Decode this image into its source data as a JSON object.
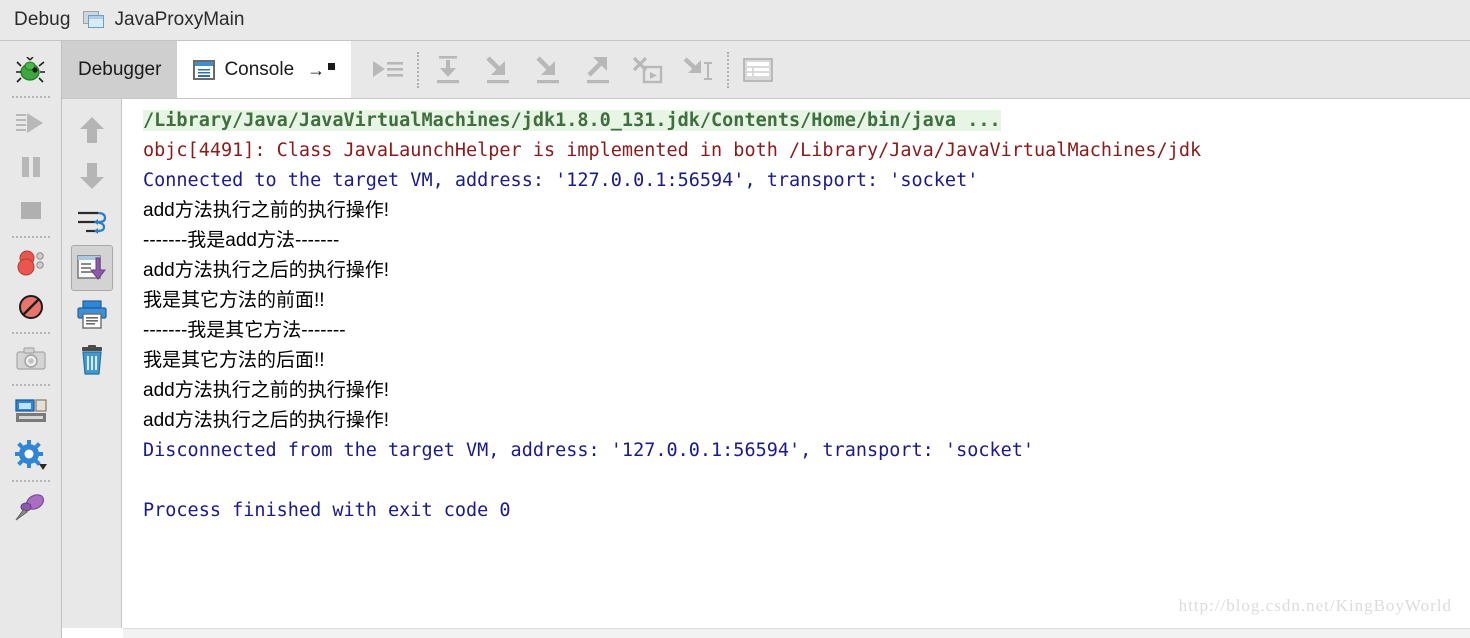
{
  "header": {
    "label": "Debug",
    "icon": "window-icon",
    "config_name": "JavaProxyMain"
  },
  "left_rail": {
    "items": [
      {
        "name": "debug-bug-icon",
        "title": "Debug"
      },
      {
        "name": "resume-program-icon",
        "title": "Resume Program"
      },
      {
        "name": "pause-program-icon",
        "title": "Pause Program"
      },
      {
        "name": "stop-icon",
        "title": "Stop"
      },
      {
        "name": "view-breakpoints-icon",
        "title": "View Breakpoints"
      },
      {
        "name": "mute-breakpoints-icon",
        "title": "Mute Breakpoints"
      },
      {
        "name": "camera-snapshot-icon",
        "title": "Get Thread Dump"
      },
      {
        "name": "restore-layout-icon",
        "title": "Restore Layout"
      },
      {
        "name": "settings-gear-icon",
        "title": "Settings"
      },
      {
        "name": "pin-tab-icon",
        "title": "Pin Tab"
      }
    ]
  },
  "tabs": [
    {
      "label": "Debugger",
      "active": false,
      "name": "tab-debugger"
    },
    {
      "label": "Console",
      "active": true,
      "name": "tab-console",
      "icon": "console-icon"
    }
  ],
  "toolbar": {
    "buttons": [
      {
        "name": "show-execution-point-icon",
        "title": "Show Execution Point"
      },
      {
        "name": "step-over-icon",
        "title": "Step Over"
      },
      {
        "name": "step-into-icon",
        "title": "Step Into"
      },
      {
        "name": "force-step-into-icon",
        "title": "Force Step Into"
      },
      {
        "name": "step-out-icon",
        "title": "Step Out"
      },
      {
        "name": "drop-frame-icon",
        "title": "Drop Frame"
      },
      {
        "name": "run-to-cursor-icon",
        "title": "Run to Cursor"
      },
      {
        "name": "evaluate-expression-icon",
        "title": "Evaluate Expression"
      }
    ]
  },
  "console_rail": {
    "buttons": [
      {
        "name": "scroll-up-icon",
        "title": "Up the Stack Trace",
        "selected": false
      },
      {
        "name": "scroll-down-icon",
        "title": "Down the Stack Trace",
        "selected": false
      },
      {
        "name": "soft-wrap-icon",
        "title": "Use Soft Wraps",
        "selected": false
      },
      {
        "name": "scroll-to-end-icon",
        "title": "Scroll to the End",
        "selected": true
      },
      {
        "name": "print-icon",
        "title": "Print",
        "selected": false
      },
      {
        "name": "clear-all-icon",
        "title": "Clear All",
        "selected": false
      }
    ]
  },
  "console": {
    "lines": [
      {
        "text": "/Library/Java/JavaVirtualMachines/jdk1.8.0_131.jdk/Contents/Home/bin/java ...",
        "style": "sysout",
        "highlight": true
      },
      {
        "text": "objc[4491]: Class JavaLaunchHelper is implemented in both /Library/Java/JavaVirtualMachines/jdk",
        "style": "error",
        "highlight": false
      },
      {
        "text": "Connected to the target VM, address: '127.0.0.1:56594', transport: 'socket'",
        "style": "info",
        "highlight": false
      },
      {
        "text": "add方法执行之前的执行操作!",
        "style": "plain",
        "highlight": false
      },
      {
        "text": "-------我是add方法-------",
        "style": "plain",
        "highlight": false
      },
      {
        "text": "add方法执行之后的执行操作!",
        "style": "plain",
        "highlight": false
      },
      {
        "text": "我是其它方法的前面!!",
        "style": "plain",
        "highlight": false
      },
      {
        "text": "-------我是其它方法-------",
        "style": "plain",
        "highlight": false
      },
      {
        "text": "我是其它方法的后面!!",
        "style": "plain",
        "highlight": false
      },
      {
        "text": "add方法执行之前的执行操作!",
        "style": "plain",
        "highlight": false
      },
      {
        "text": "add方法执行之后的执行操作!",
        "style": "plain",
        "highlight": false
      },
      {
        "text": "Disconnected from the target VM, address: '127.0.0.1:56594', transport: 'socket'",
        "style": "info",
        "highlight": false
      },
      {
        "text": "",
        "style": "plain",
        "highlight": false
      },
      {
        "text": "Process finished with exit code 0",
        "style": "info",
        "highlight": false
      }
    ]
  },
  "watermark": {
    "text": "http://blog.csdn.net/KingBoyWorld"
  },
  "colors": {
    "toolbar_bg": "#e8e8e8",
    "header_bg": "#e9e9e9",
    "tab_inactive_bg": "#cfcfcf",
    "tab_active_bg": "#ffffff",
    "console_bg": "#ffffff",
    "sysout": "#3f6e3f",
    "sysout_highlight": "#e7f5e4",
    "error": "#8b1a1a",
    "info": "#1a1a8c",
    "plain": "#000000"
  }
}
